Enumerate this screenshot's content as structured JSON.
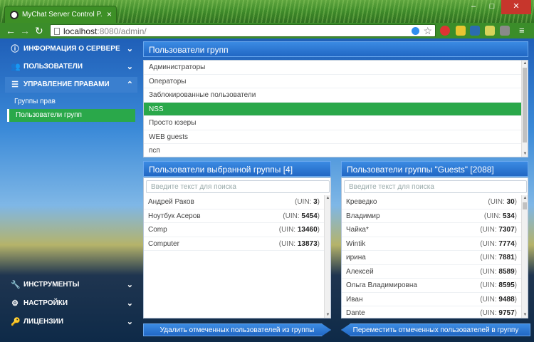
{
  "browser": {
    "tab_title": "MyChat Server Control P...",
    "url_host": "localhost",
    "url_rest": ":8080/admin/"
  },
  "sidebar": {
    "items": [
      {
        "label": "ИНФОРМАЦИЯ О СЕРВЕРЕ",
        "icon": "info-icon"
      },
      {
        "label": "ПОЛЬЗОВАТЕЛИ",
        "icon": "users-icon"
      },
      {
        "label": "УПРАВЛЕНИЕ ПРАВАМИ",
        "icon": "list-icon"
      },
      {
        "label": "ИНСТРУМЕНТЫ",
        "icon": "wrench-icon"
      },
      {
        "label": "НАСТРОЙКИ",
        "icon": "gears-icon"
      },
      {
        "label": "ЛИЦЕНЗИИ",
        "icon": "key-icon"
      }
    ],
    "subitems": [
      "Группы прав",
      "Пользователи групп"
    ]
  },
  "groups_panel": {
    "title": "Пользователи групп",
    "groups": [
      "Администраторы",
      "Операторы",
      "Заблокированные пользователи",
      "NSS",
      "Просто юзеры",
      "WEB guests",
      "псп"
    ],
    "selected": "NSS"
  },
  "left_panel": {
    "title": "Пользователи выбранной группы [4]",
    "search_placeholder": "Введите текст для поиска",
    "users": [
      {
        "name": "Андрей Раков",
        "uin_label": "(UIN: ",
        "uin": "3",
        "close": ")"
      },
      {
        "name": "Ноутбук Асеров",
        "uin_label": "(UIN: ",
        "uin": "5454",
        "close": ")"
      },
      {
        "name": "Comp",
        "uin_label": "(UIN: ",
        "uin": "13460",
        "close": ")"
      },
      {
        "name": "Computer",
        "uin_label": "(UIN: ",
        "uin": "13873",
        "close": ")"
      }
    ],
    "action": "Удалить отмеченных пользователей из группы"
  },
  "right_panel": {
    "title": "Пользователи группы \"Guests\" [2088]",
    "search_placeholder": "Введите текст для поиска",
    "users": [
      {
        "name": "Креведко",
        "uin_label": "(UIN: ",
        "uin": "30",
        "close": ")"
      },
      {
        "name": "Владимир",
        "uin_label": "(UIN: ",
        "uin": "534",
        "close": ")"
      },
      {
        "name": "Чайка*",
        "uin_label": "(UIN: ",
        "uin": "7307",
        "close": ")"
      },
      {
        "name": "Wintik",
        "uin_label": "(UIN: ",
        "uin": "7774",
        "close": ")"
      },
      {
        "name": "ирина",
        "uin_label": "(UIN: ",
        "uin": "7881",
        "close": ")"
      },
      {
        "name": "Алексей",
        "uin_label": "(UIN: ",
        "uin": "8589",
        "close": ")"
      },
      {
        "name": "Ольга Владимировна",
        "uin_label": "(UIN: ",
        "uin": "8595",
        "close": ")"
      },
      {
        "name": "Иван",
        "uin_label": "(UIN: ",
        "uin": "9488",
        "close": ")"
      },
      {
        "name": "Dante",
        "uin_label": "(UIN: ",
        "uin": "9757",
        "close": ")"
      }
    ],
    "action": "Переместить отмеченных пользователей в группу"
  }
}
